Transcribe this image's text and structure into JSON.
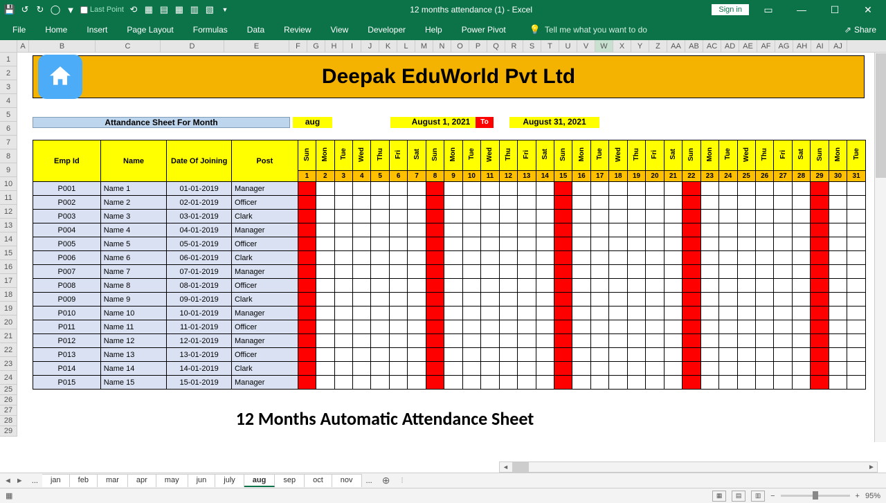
{
  "title": "12 months attendance (1)  -  Excel",
  "signin": "Sign in",
  "lastpoint": "Last Point",
  "tabs": [
    "File",
    "Home",
    "Insert",
    "Page Layout",
    "Formulas",
    "Data",
    "Review",
    "View",
    "Developer",
    "Help",
    "Power Pivot"
  ],
  "tellme": "Tell me what you want to do",
  "share": "Share",
  "cols": [
    "A",
    "B",
    "C",
    "D",
    "E",
    "F",
    "G",
    "H",
    "I",
    "J",
    "K",
    "L",
    "M",
    "N",
    "O",
    "P",
    "Q",
    "R",
    "S",
    "T",
    "U",
    "V",
    "W",
    "X",
    "Y",
    "Z",
    "AA",
    "AB",
    "AC",
    "AD",
    "AE",
    "AF",
    "AG",
    "AH",
    "AI",
    "AJ"
  ],
  "rows": [
    "1",
    "2",
    "3",
    "4",
    "5",
    "6",
    "7",
    "8",
    "9",
    "10",
    "11",
    "12",
    "13",
    "14",
    "15",
    "16",
    "17",
    "18",
    "19",
    "20",
    "21",
    "22",
    "23",
    "24",
    "25",
    "26",
    "27",
    "28",
    "29"
  ],
  "company": "Deepak EduWorld Pvt Ltd",
  "month_label": "Attandance Sheet For Month",
  "month_val": "aug",
  "date_from": "August 1, 2021",
  "date_to": "To",
  "date_end": "August 31, 2021",
  "headers": [
    "Emp Id",
    "Name",
    "Date Of Joining",
    "Post"
  ],
  "days": [
    "Sun",
    "Mon",
    "Tue",
    "Wed",
    "Thu",
    "Fri",
    "Sat",
    "Sun",
    "Mon",
    "Tue",
    "Wed",
    "Thu",
    "Fri",
    "Sat",
    "Sun",
    "Mon",
    "Tue",
    "Wed",
    "Thu",
    "Fri",
    "Sat",
    "Sun",
    "Mon",
    "Tue",
    "Wed",
    "Thu",
    "Fri",
    "Sat",
    "Sun",
    "Mon",
    "Tue"
  ],
  "daynums": [
    "1",
    "2",
    "3",
    "4",
    "5",
    "6",
    "7",
    "8",
    "9",
    "10",
    "11",
    "12",
    "13",
    "14",
    "15",
    "16",
    "17",
    "18",
    "19",
    "20",
    "21",
    "22",
    "23",
    "24",
    "25",
    "26",
    "27",
    "28",
    "29",
    "30",
    "31"
  ],
  "sundays": [
    0,
    7,
    14,
    21,
    28
  ],
  "emps": [
    {
      "id": "P001",
      "name": "Name 1",
      "doj": "01-01-2019",
      "post": "Manager"
    },
    {
      "id": "P002",
      "name": "Name 2",
      "doj": "02-01-2019",
      "post": "Officer"
    },
    {
      "id": "P003",
      "name": "Name 3",
      "doj": "03-01-2019",
      "post": "Clark"
    },
    {
      "id": "P004",
      "name": "Name 4",
      "doj": "04-01-2019",
      "post": "Manager"
    },
    {
      "id": "P005",
      "name": "Name 5",
      "doj": "05-01-2019",
      "post": "Officer"
    },
    {
      "id": "P006",
      "name": "Name 6",
      "doj": "06-01-2019",
      "post": "Clark"
    },
    {
      "id": "P007",
      "name": "Name 7",
      "doj": "07-01-2019",
      "post": "Manager"
    },
    {
      "id": "P008",
      "name": "Name 8",
      "doj": "08-01-2019",
      "post": "Officer"
    },
    {
      "id": "P009",
      "name": "Name 9",
      "doj": "09-01-2019",
      "post": "Clark"
    },
    {
      "id": "P010",
      "name": "Name 10",
      "doj": "10-01-2019",
      "post": "Manager"
    },
    {
      "id": "P011",
      "name": "Name 11",
      "doj": "11-01-2019",
      "post": "Officer"
    },
    {
      "id": "P012",
      "name": "Name 12",
      "doj": "12-01-2019",
      "post": "Manager"
    },
    {
      "id": "P013",
      "name": "Name 13",
      "doj": "13-01-2019",
      "post": "Officer"
    },
    {
      "id": "P014",
      "name": "Name 14",
      "doj": "14-01-2019",
      "post": "Clark"
    },
    {
      "id": "P015",
      "name": "Name 15",
      "doj": "15-01-2019",
      "post": "Manager"
    }
  ],
  "subtitle": "12 Months Automatic Attendance Sheet",
  "sheet_tabs": [
    "jan",
    "feb",
    "mar",
    "apr",
    "may",
    "jun",
    "july",
    "aug",
    "sep",
    "oct",
    "nov"
  ],
  "active_tab": "aug",
  "zoom": "95%",
  "col_widths": {
    "A": 17,
    "B": 96,
    "C": 94,
    "D": 92,
    "E": 94,
    "day": 26
  }
}
